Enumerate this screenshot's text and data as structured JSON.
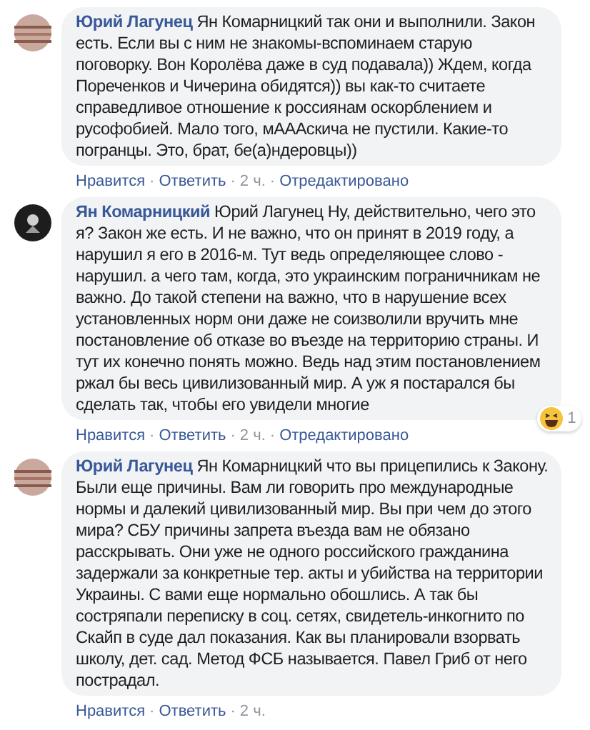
{
  "separator": "·",
  "comments": [
    {
      "author": "Юрий Лагунец",
      "avatar": {
        "kind": "pattern"
      },
      "text": "Ян Комарницкий так они и выполнили. Закон есть. Если вы с ним не знакомы-вспоминаем старую поговорку. Вон Королёва даже в суд подавала)) Ждем, когда Пореченков и Чичерина обидятся)) вы как-то считаете справедливое отношение к россиянам оскорблением и русофобией. Мало того, мАААскича не пустили. Какие-то погранцы. Это, брат, бе(а)ндеровцы))",
      "actions": [
        "Нравится",
        "Ответить",
        "2 ч.",
        "Отредактировано"
      ]
    },
    {
      "author": "Ян Комарницкий",
      "avatar": {
        "kind": "dark"
      },
      "text": "Юрий Лагунец Ну, действительно, чего это я? Закон же есть. И не важно, что он принят в 2019 году, а нарушил я его в 2016-м. Тут ведь определяющее слово - нарушил. а чего там, когда, это украинским пограничникам не важно. До такой степени на важно, что в нарушение всех установленных норм они даже не соизволили вручить мне постановление об отказе во въезде на территорию страны. И тут их конечно понять можно. Ведь над этим постановлением ржал бы весь цивилизованный мир. А уж я постарался бы сделать так, чтобы его увидели многие",
      "actions": [
        "Нравится",
        "Ответить",
        "2 ч.",
        "Отредактировано"
      ],
      "reaction": {
        "count": "1"
      }
    },
    {
      "author": "Юрий Лагунец",
      "avatar": {
        "kind": "pattern"
      },
      "text": "Ян Комарницкий что вы прицепились к Закону. Были еще причины. Вам ли говорить про международные нормы и далекий цивилизованный мир. Вы при чем до этого мира? СБУ причины запрета въезда вам не обязано расскрывать. Они уже не одного российского гражданина задержали за конкретные тер. акты и убийства на территории Украины. С вами еще нормально обошлись. А так бы состряпали переписку в соц. сетях, свидетель-инкогнито по Скайп в суде дал показания. Как вы планировали взорвать школу, дет. сад. Метод ФСБ называется. Павел Гриб от него пострадал.",
      "actions": [
        "Нравится",
        "Ответить",
        "2 ч."
      ]
    }
  ]
}
